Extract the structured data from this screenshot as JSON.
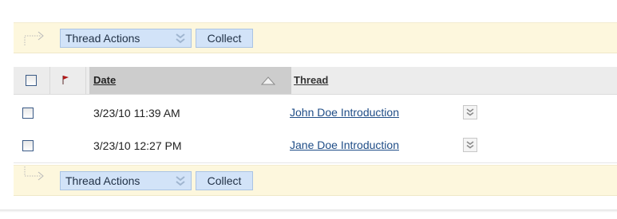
{
  "action_bar": {
    "thread_actions_label": "Thread Actions",
    "collect_label": "Collect"
  },
  "table": {
    "columns": {
      "date": "Date",
      "thread": "Thread"
    },
    "sorted_by": "Date",
    "sort_direction": "ascending",
    "rows": [
      {
        "date": "3/23/10 11:39 AM",
        "thread": "John Doe Introduction"
      },
      {
        "date": "3/23/10 12:27 PM",
        "thread": "Jane Doe Introduction"
      }
    ]
  },
  "icons": {
    "flag": "flag-icon",
    "sort": "sort-ascending-icon",
    "menu": "double-chevron-down-icon",
    "connector": "connector-arrow-icon"
  },
  "colors": {
    "action_bar_bg": "#fdf7dd",
    "button_bg": "#d2e3f8",
    "link": "#1f4d87",
    "flag": "#b01818"
  }
}
